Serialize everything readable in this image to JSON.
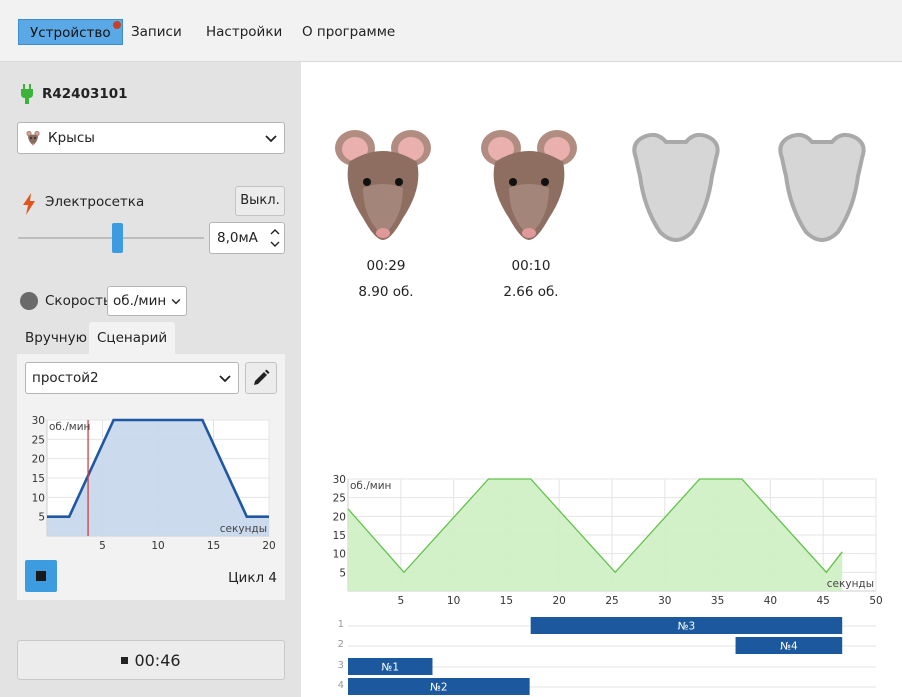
{
  "menu": {
    "items": [
      "Устройство",
      "Записи",
      "Настройки",
      "О программе"
    ],
    "active": "Устройство"
  },
  "device": {
    "id": "R42403101",
    "connected_color": "#3bb33b"
  },
  "animal_select": {
    "value": "Крысы"
  },
  "shock": {
    "label": "Электросетка",
    "toggle_label": "Выкл.",
    "current": "8,0мА",
    "slider_level": 0.49
  },
  "speed": {
    "label": "Скорость",
    "unit_value": "об./мин"
  },
  "tabs": {
    "manual": "Вручную",
    "scenario": "Сценарий",
    "active": "Сценарий"
  },
  "scenario": {
    "select_value": "простой2",
    "cycle_label": "Цикл 4"
  },
  "timer": {
    "value": "00:46"
  },
  "subjects": [
    {
      "present": true,
      "time": "00:29",
      "revs": "8.90 об."
    },
    {
      "present": true,
      "time": "00:10",
      "revs": "2.66 об."
    },
    {
      "present": false
    },
    {
      "present": false
    }
  ],
  "chart_data": [
    {
      "type": "area",
      "ylabel": "об./мин",
      "xlabel": "секунды",
      "xlim": [
        0,
        20
      ],
      "ylim": [
        0,
        30
      ],
      "xticks": [
        5,
        10,
        15,
        20
      ],
      "yticks": [
        5,
        10,
        15,
        20,
        25,
        30
      ],
      "grid": true,
      "x": [
        0,
        2,
        6,
        14,
        18,
        20
      ],
      "y": [
        5,
        5,
        30,
        30,
        5,
        5
      ],
      "cursor_x": 3.7,
      "colors": {
        "line": "#1f57a3",
        "fill": "#c5d6ea",
        "cursor": "#d04040"
      }
    },
    {
      "type": "area",
      "ylabel": "об./мин",
      "xlabel": "секунды",
      "xlim": [
        0,
        50
      ],
      "ylim": [
        0,
        30
      ],
      "xticks": [
        5,
        10,
        15,
        20,
        25,
        30,
        35,
        40,
        45,
        50
      ],
      "yticks": [
        5,
        10,
        15,
        20,
        25,
        30
      ],
      "grid": true,
      "x": [
        0,
        5.3,
        13.3,
        17.3,
        25.3,
        33.3,
        37.3,
        45.3,
        46.8
      ],
      "y": [
        22,
        5,
        30,
        30,
        5,
        30,
        30,
        5,
        10.5
      ],
      "colors": {
        "line": "#62c24a",
        "fill": "#cdf0c2"
      }
    }
  ],
  "timeline": {
    "rows": [
      {
        "label": "1",
        "bars": [
          {
            "name": "№3",
            "start": 17.3,
            "end": 46.8
          }
        ]
      },
      {
        "label": "2",
        "bars": [
          {
            "name": "№4",
            "start": 36.7,
            "end": 46.8
          }
        ]
      },
      {
        "label": "3",
        "bars": [
          {
            "name": "№1",
            "start": 0,
            "end": 8
          }
        ]
      },
      {
        "label": "4",
        "bars": [
          {
            "name": "№2",
            "start": 0,
            "end": 17.2
          }
        ]
      }
    ],
    "bar_color": "#1b589e"
  }
}
